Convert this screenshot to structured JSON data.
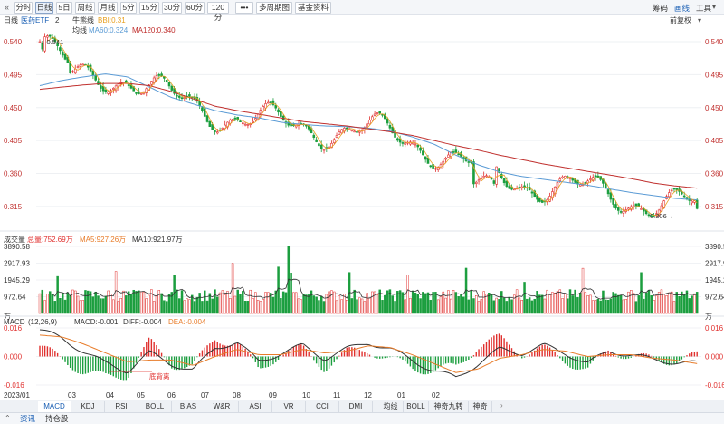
{
  "toolbar": {
    "collapse_icon": "collapse-left-icon",
    "buttons": [
      "分时",
      "日线",
      "5日",
      "周线",
      "月线",
      "5分",
      "15分",
      "30分",
      "60分",
      "120分",
      "•••",
      "多周期图",
      "基金资料"
    ],
    "active_button": "日线",
    "right_items": [
      "筹码",
      "画线",
      "工具"
    ],
    "active_right": "画线"
  },
  "legend": {
    "row1": [
      "日线",
      "医药ETF",
      "2"
    ],
    "row1_label_bull": "牛熊线",
    "row1_bbi": "BBI:0.31",
    "row2_label": "均线",
    "row2_ma60": "MA60:0.324",
    "row2_ma120": "MA120:0.340",
    "adjust": "前复权"
  },
  "colors": {
    "up": "#e0302e",
    "down": "#1b9e3e",
    "ma60": "#5b9bd5",
    "ma120": "#c0302e",
    "bbi": "#e8a020",
    "macd_dif": "#333333",
    "macd_dea": "#e87c2a"
  },
  "price_panel": {
    "y_ticks": [
      "0.540",
      "0.495",
      "0.450",
      "0.405",
      "0.360",
      "0.315"
    ],
    "ylim": [
      0.3,
      0.545
    ],
    "high_label": "0.541",
    "low_label": "0.306"
  },
  "volume_panel": {
    "header_label": "成交量",
    "header_total": "总量:752.69万",
    "header_ma5": "MA5:927.26万",
    "header_ma10": "MA10:921.97万",
    "y_ticks": [
      "3890.58",
      "2917.93",
      "1945.29",
      "972.64",
      "万"
    ],
    "ymax": 3890.58
  },
  "macd_panel": {
    "header_label": "MACD",
    "header_params": "(12,26,9)",
    "header_macd": "MACD:-0.001",
    "header_diff": "DIFF:-0.004",
    "header_dea": "DEA:-0.004",
    "y_ticks": [
      "0.016",
      "0.000",
      "-0.016"
    ],
    "annotation": "底背离"
  },
  "x_axis": {
    "labels": [
      "2023/01",
      "03",
      "04",
      "05",
      "06",
      "07",
      "08",
      "09",
      "10",
      "11",
      "12",
      "01",
      "02"
    ]
  },
  "indicator_tabs": {
    "left": [
      "MACD",
      "KDJ",
      "RSI",
      "BOLL",
      "BIAS",
      "W&R",
      "ASI",
      "VR",
      "CCI",
      "DMI"
    ],
    "active_left": "MACD",
    "right": [
      "均线",
      "BOLL",
      "神奇九转",
      "神奇"
    ]
  },
  "footer_tabs": {
    "items": [
      "资讯",
      "持仓股"
    ],
    "active": "资讯"
  },
  "chart_data": {
    "type": "candlestick",
    "x_range": [
      "2023/01",
      "2024/02"
    ],
    "ylim": [
      0.3,
      0.545
    ],
    "series": [
      {
        "name": "MA60",
        "values": [
          0.48,
          0.487,
          0.492,
          0.496,
          0.492,
          0.478,
          0.464,
          0.455,
          0.446,
          0.44,
          0.436,
          0.43,
          0.427,
          0.425,
          0.424,
          0.422,
          0.418,
          0.41,
          0.4,
          0.385,
          0.372,
          0.362,
          0.356,
          0.352,
          0.348,
          0.344,
          0.339,
          0.334,
          0.33,
          0.326,
          0.324
        ]
      },
      {
        "name": "MA120",
        "values": [
          0.475,
          0.478,
          0.481,
          0.483,
          0.483,
          0.48,
          0.472,
          0.462,
          0.452,
          0.446,
          0.441,
          0.436,
          0.431,
          0.428,
          0.425,
          0.421,
          0.417,
          0.412,
          0.405,
          0.398,
          0.392,
          0.385,
          0.379,
          0.373,
          0.368,
          0.363,
          0.358,
          0.353,
          0.347,
          0.343,
          0.34
        ]
      }
    ],
    "macd": {
      "dif": [
        0.015,
        0.01,
        0.003,
        -0.004,
        -0.008,
        0.002,
        -0.004,
        -0.008,
        0.005,
        0.008,
        -0.003,
        0.002,
        0.006,
        -0.001,
        0.004,
        0.008,
        0.004,
        -0.002,
        -0.008,
        -0.012,
        -0.004,
        0.004,
        0.002,
        0.006,
        0.002,
        -0.004,
        0.003,
        0.001,
        -0.002,
        -0.003,
        -0.004
      ],
      "dea": [
        0.012,
        0.011,
        0.007,
        0.002,
        -0.003,
        -0.002,
        -0.002,
        -0.005,
        0.0,
        0.004,
        0.001,
        0.001,
        0.004,
        0.002,
        0.003,
        0.006,
        0.005,
        0.001,
        -0.004,
        -0.009,
        -0.007,
        -0.001,
        0.001,
        0.004,
        0.003,
        0.0,
        0.001,
        0.001,
        -0.001,
        -0.002,
        -0.004
      ]
    }
  }
}
